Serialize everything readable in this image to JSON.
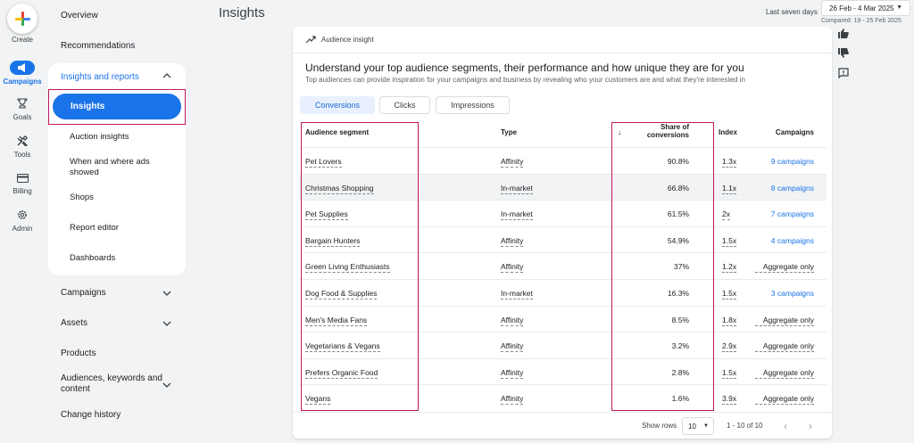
{
  "rail": {
    "create": "Create",
    "campaigns": "Campaigns",
    "goals": "Goals",
    "tools": "Tools",
    "billing": "Billing",
    "admin": "Admin"
  },
  "nav": {
    "overview": "Overview",
    "recommendations": "Recommendations",
    "insights_group": "Insights and reports",
    "insights": "Insights",
    "auction": "Auction insights",
    "when_where_1": "When and where ads",
    "when_where_2": "showed",
    "shops": "Shops",
    "report_editor": "Report editor",
    "dashboards": "Dashboards",
    "campaigns": "Campaigns",
    "assets": "Assets",
    "products": "Products",
    "audiences_1": "Audiences, keywords and",
    "audiences_2": "content",
    "change_history": "Change history"
  },
  "header": {
    "title": "Insights",
    "range_label": "Last seven days",
    "date_range": "26 Feb - 4 Mar 2025",
    "compared": "Compared: 19 - 25 Feb 2025"
  },
  "card": {
    "head_label": "Audience insight",
    "title": "Understand your top audience segments, their performance and how unique they are for you",
    "subtitle": "Top audiences can provide inspiration for your campaigns and business by revealing who your customers are and what they're interested in",
    "tabs": [
      "Conversions",
      "Clicks",
      "Impressions"
    ],
    "columns": {
      "segment": "Audience segment",
      "type": "Type",
      "share_1": "Share of",
      "share_2": "conversions",
      "index": "Index",
      "campaigns": "Campaigns"
    },
    "rows": [
      {
        "segment": "Pet Lovers",
        "type": "Affinity",
        "share": "90.8%",
        "index": "1.3x",
        "campaigns": "9 campaigns"
      },
      {
        "segment": "Christmas Shopping",
        "type": "In-market",
        "share": "66.8%",
        "index": "1.1x",
        "campaigns": "8 campaigns"
      },
      {
        "segment": "Pet Supplies",
        "type": "In-market",
        "share": "61.5%",
        "index": "2x",
        "campaigns": "7 campaigns"
      },
      {
        "segment": "Bargain Hunters",
        "type": "Affinity",
        "share": "54.9%",
        "index": "1.5x",
        "campaigns": "4 campaigns"
      },
      {
        "segment": "Green Living Enthusiasts",
        "type": "Affinity",
        "share": "37%",
        "index": "1.2x",
        "campaigns": "Aggregate only"
      },
      {
        "segment": "Dog Food & Supplies",
        "type": "In-market",
        "share": "16.3%",
        "index": "1.5x",
        "campaigns": "3 campaigns"
      },
      {
        "segment": "Men's Media Fans",
        "type": "Affinity",
        "share": "8.5%",
        "index": "1.8x",
        "campaigns": "Aggregate only"
      },
      {
        "segment": "Vegetarians & Vegans",
        "type": "Affinity",
        "share": "3.2%",
        "index": "2.9x",
        "campaigns": "Aggregate only"
      },
      {
        "segment": "Prefers Organic Food",
        "type": "Affinity",
        "share": "2.8%",
        "index": "1.5x",
        "campaigns": "Aggregate only"
      },
      {
        "segment": "Vegans",
        "type": "Affinity",
        "share": "1.6%",
        "index": "3.9x",
        "campaigns": "Aggregate only"
      }
    ],
    "footer": {
      "show_rows": "Show rows",
      "rows_value": "10",
      "range": "1 - 10 of 10"
    }
  },
  "colors": {
    "accent": "#1a73e8",
    "highlight": "#c2185b"
  }
}
